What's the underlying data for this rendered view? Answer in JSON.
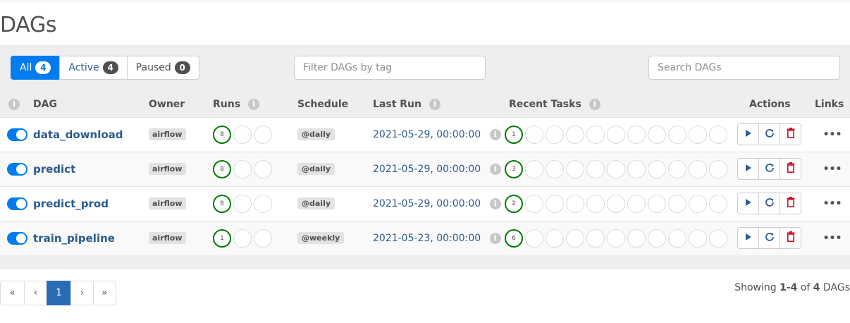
{
  "page": {
    "title": "DAGs"
  },
  "filters": {
    "all": {
      "label": "All",
      "count": "4"
    },
    "active": {
      "label": "Active",
      "count": "4"
    },
    "paused": {
      "label": "Paused",
      "count": "0"
    },
    "tag_placeholder": "Filter DAGs by tag",
    "search_placeholder": "Search DAGs"
  },
  "columns": {
    "dag": "DAG",
    "owner": "Owner",
    "runs": "Runs",
    "schedule": "Schedule",
    "last_run": "Last Run",
    "recent_tasks": "Recent Tasks",
    "actions": "Actions",
    "links": "Links"
  },
  "info_glyph": "i",
  "more_glyph": "•••",
  "dags": [
    {
      "name": "data_download",
      "owner": "airflow",
      "runs": "8",
      "schedule": "@daily",
      "last_run": "2021-05-29, 00:00:00",
      "tasks": "1"
    },
    {
      "name": "predict",
      "owner": "airflow",
      "runs": "8",
      "schedule": "@daily",
      "last_run": "2021-05-29, 00:00:00",
      "tasks": "3"
    },
    {
      "name": "predict_prod",
      "owner": "airflow",
      "runs": "8",
      "schedule": "@daily",
      "last_run": "2021-05-29, 00:00:00",
      "tasks": "2"
    },
    {
      "name": "train_pipeline",
      "owner": "airflow",
      "runs": "1",
      "schedule": "@weekly",
      "last_run": "2021-05-23, 00:00:00",
      "tasks": "6"
    }
  ],
  "pagination": {
    "first": "«",
    "prev": "‹",
    "current": "1",
    "next": "›",
    "last": "»"
  },
  "footer": {
    "showing": "Showing",
    "range": "1-4",
    "of": "of",
    "total": "4",
    "suffix": "DAGs"
  },
  "colors": {
    "accent": "#017cee",
    "link": "#2a5b91",
    "success": "#007d00",
    "danger": "#cc1122"
  }
}
